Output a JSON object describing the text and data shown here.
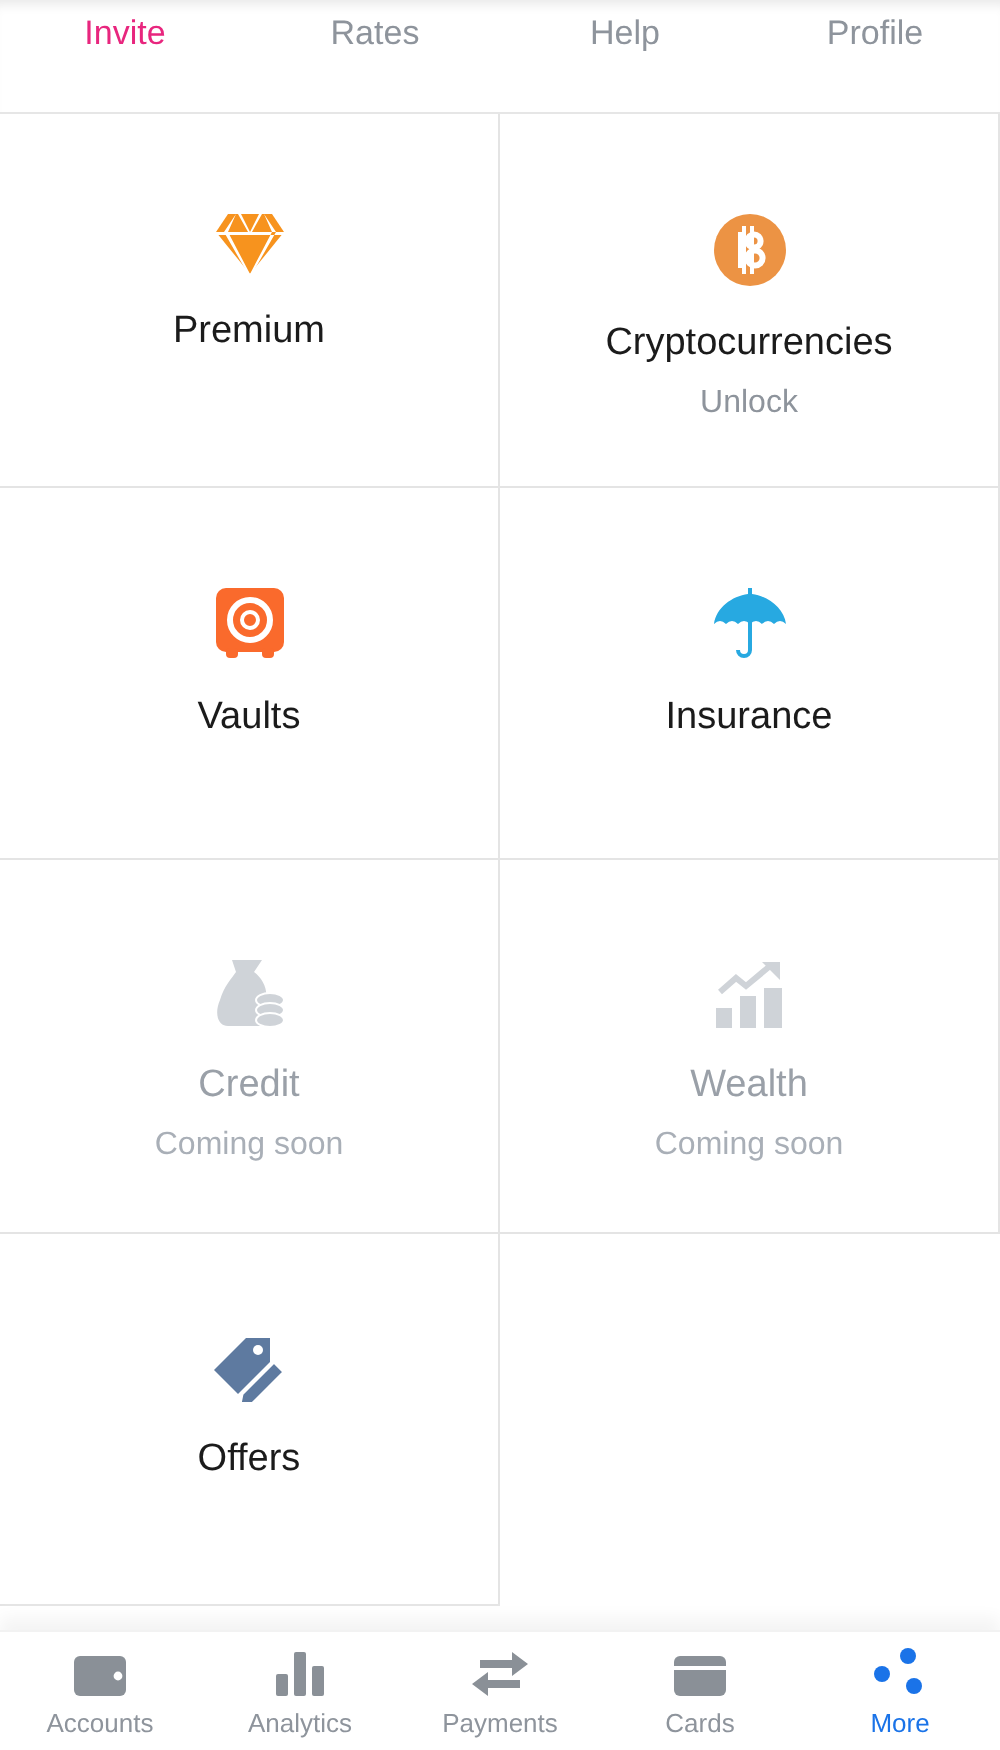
{
  "top_tabs": [
    {
      "label": "Invite",
      "selected": true
    },
    {
      "label": "Rates",
      "selected": false
    },
    {
      "label": "Help",
      "selected": false
    },
    {
      "label": "Profile",
      "selected": false
    }
  ],
  "tiles": [
    {
      "title": "Premium",
      "disabled": false
    },
    {
      "title": "Cryptocurrencies",
      "subtitle": "Unlock",
      "disabled": false
    },
    {
      "title": "Vaults",
      "disabled": false
    },
    {
      "title": "Insurance",
      "disabled": false
    },
    {
      "title": "Credit",
      "subtitle": "Coming soon",
      "disabled": true
    },
    {
      "title": "Wealth",
      "subtitle": "Coming soon",
      "disabled": true
    },
    {
      "title": "Offers",
      "disabled": false
    }
  ],
  "bottom_nav": [
    {
      "label": "Accounts",
      "selected": false
    },
    {
      "label": "Analytics",
      "selected": false
    },
    {
      "label": "Payments",
      "selected": false
    },
    {
      "label": "Cards",
      "selected": false
    },
    {
      "label": "More",
      "selected": true
    }
  ]
}
